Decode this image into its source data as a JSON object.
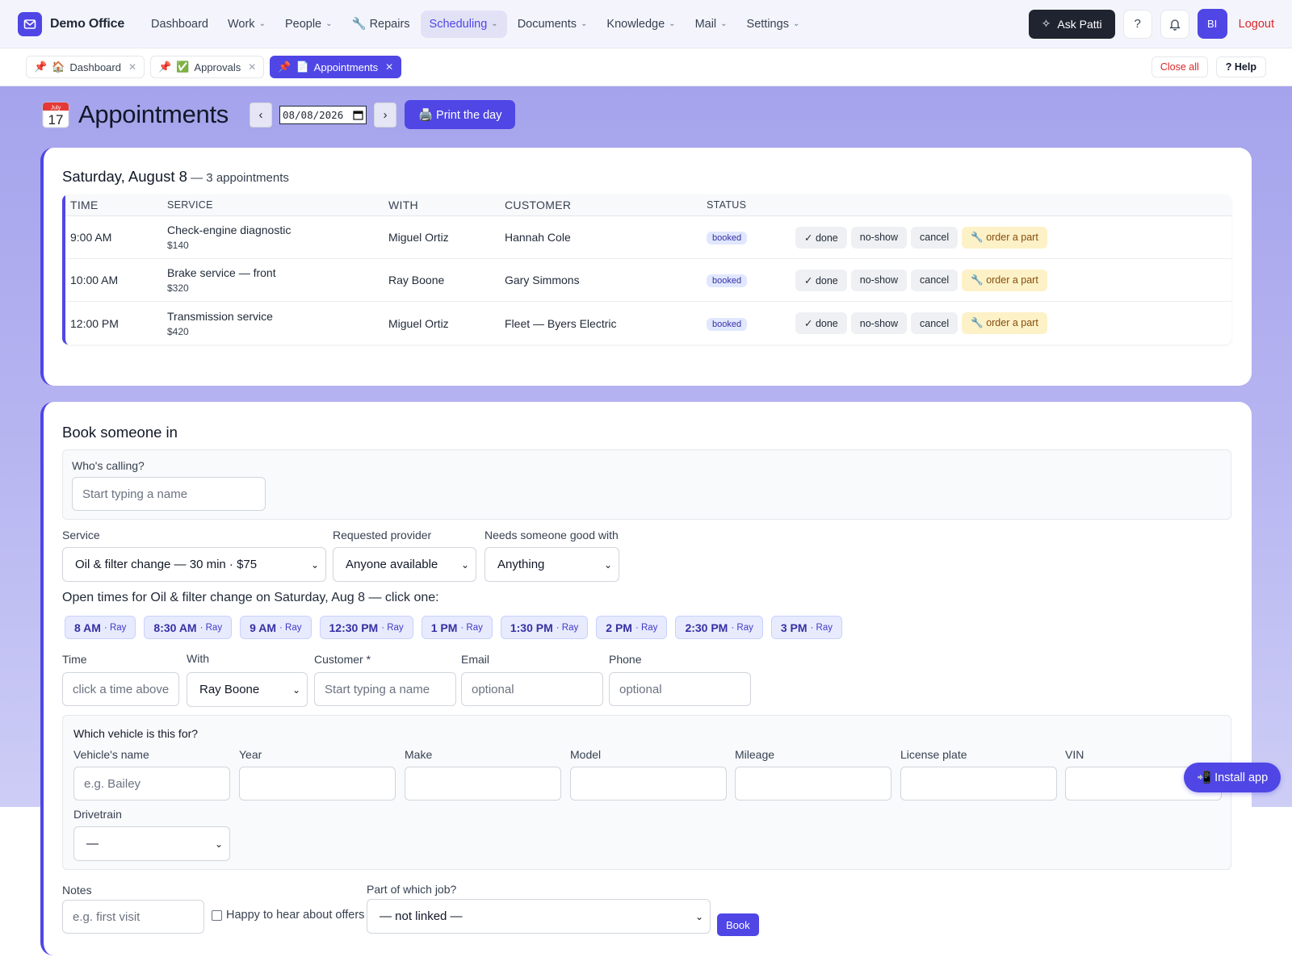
{
  "app": {
    "brand": "Demo Office"
  },
  "nav": {
    "items": [
      {
        "label": "Dashboard",
        "has_menu": false
      },
      {
        "label": "Work",
        "has_menu": true
      },
      {
        "label": "People",
        "has_menu": true
      },
      {
        "label": "🔧 Repairs",
        "has_menu": false
      },
      {
        "label": "Scheduling",
        "has_menu": true,
        "active": true
      },
      {
        "label": "Documents",
        "has_menu": true
      },
      {
        "label": "Knowledge",
        "has_menu": true
      },
      {
        "label": "Mail",
        "has_menu": true
      },
      {
        "label": "Settings",
        "has_menu": true
      }
    ],
    "ask_label": "Ask Patti",
    "help_label": "?",
    "avatar_initials": "BI",
    "logout_label": "Logout"
  },
  "tabs": {
    "items": [
      {
        "pin": "📌",
        "icon": "🏠",
        "label": "Dashboard"
      },
      {
        "pin": "📌",
        "icon": "✅",
        "label": "Approvals"
      },
      {
        "pin": "📌",
        "icon": "📄",
        "label": "Appointments",
        "active": true
      }
    ],
    "close_all": "Close all",
    "help": "? Help"
  },
  "page": {
    "icon": "calendar-icon",
    "icon_month": "July",
    "icon_day": "17",
    "title": "Appointments",
    "prev": "‹",
    "next": "›",
    "date_value": "08/08/2026",
    "print_label": "🖨️ Print the day"
  },
  "day": {
    "heading": "Saturday, August 8",
    "count": " — 3 appointments",
    "columns": [
      "TIME",
      "SERVICE",
      "WITH",
      "CUSTOMER",
      "STATUS"
    ],
    "rows": [
      {
        "time": "9:00 AM",
        "service": "Check-engine diagnostic",
        "price": "$140",
        "with": "Miguel Ortiz",
        "customer": "Hannah Cole",
        "status": "booked"
      },
      {
        "time": "10:00 AM",
        "service": "Brake service — front",
        "price": "$320",
        "with": "Ray Boone",
        "customer": "Gary Simmons",
        "status": "booked"
      },
      {
        "time": "12:00 PM",
        "service": "Transmission service",
        "price": "$420",
        "with": "Miguel Ortiz",
        "customer": "Fleet — Byers Electric",
        "status": "booked"
      }
    ],
    "actions": {
      "done": "✓ done",
      "noshow": "no-show",
      "cancel": "cancel",
      "part": "🔧 order a part"
    }
  },
  "booking": {
    "title": "Book someone in",
    "caller_label": "Who's calling?",
    "caller_placeholder": "Start typing a name",
    "service_label": "Service",
    "service_value": "Oil & filter change — 30 min · $75",
    "provider_label": "Requested provider",
    "provider_value": "Anyone available",
    "skill_label": "Needs someone good with",
    "skill_value": "Anything",
    "open_times_label": "Open times for Oil & filter change on Saturday, Aug 8 — click one:",
    "slots": [
      {
        "time": "8 AM",
        "with": "· Ray"
      },
      {
        "time": "8:30 AM",
        "with": "· Ray"
      },
      {
        "time": "9 AM",
        "with": "· Ray"
      },
      {
        "time": "12:30 PM",
        "with": "· Ray"
      },
      {
        "time": "1 PM",
        "with": "· Ray"
      },
      {
        "time": "1:30 PM",
        "with": "· Ray"
      },
      {
        "time": "2 PM",
        "with": "· Ray"
      },
      {
        "time": "2:30 PM",
        "with": "· Ray"
      },
      {
        "time": "3 PM",
        "with": "· Ray"
      }
    ],
    "time_label": "Time",
    "time_placeholder": "click a time above",
    "with_label": "With",
    "with_value": "Ray Boone",
    "customer_label": "Customer *",
    "customer_placeholder": "Start typing a name",
    "email_label": "Email",
    "email_placeholder": "optional",
    "phone_label": "Phone",
    "phone_placeholder": "optional",
    "vehicle": {
      "heading": "Which vehicle is this for?",
      "name_label": "Vehicle's name",
      "name_placeholder": "e.g. Bailey",
      "year_label": "Year",
      "make_label": "Make",
      "model_label": "Model",
      "mileage_label": "Mileage",
      "plate_label": "License plate",
      "vin_label": "VIN",
      "drivetrain_label": "Drivetrain",
      "drivetrain_value": "—"
    },
    "notes_label": "Notes",
    "notes_placeholder": "e.g. first visit",
    "offers_label": "Happy to hear about offers",
    "job_label": "Part of which job?",
    "job_value": "— not linked —",
    "book_label": "Book"
  },
  "install_label": "📲 Install app"
}
